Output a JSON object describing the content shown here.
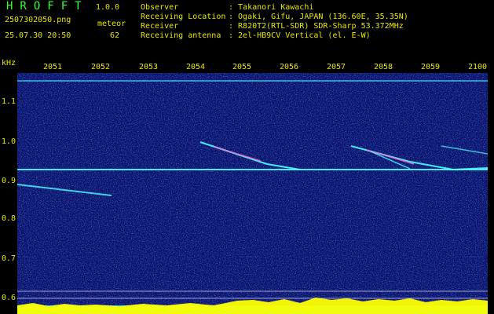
{
  "app": {
    "title": "HROFFT",
    "version": "1.0.0"
  },
  "file": {
    "name": "2507302050.png",
    "mode": "meteor",
    "datetime": "25.07.30 20:50",
    "count": "62"
  },
  "info": [
    {
      "label": "Observer",
      "value": ": Takanori Kawachi"
    },
    {
      "label": "Receiving Location",
      "value": ": Ogaki, Gifu, JAPAN (136.60E, 35.35N)"
    },
    {
      "label": "Receiver",
      "value": ": R820T2(RTL-SDR) SDR-Sharp 53.372MHz"
    },
    {
      "label": "Receiving antenna",
      "value": ": 2el-HB9CV Vertical (el. E-W)"
    }
  ],
  "axis": {
    "unit": "kHz",
    "time_labels": [
      "2051",
      "2052",
      "2053",
      "2054",
      "2055",
      "2056",
      "2057",
      "2058",
      "2059",
      "2100"
    ],
    "freq_labels": [
      "1.1",
      "1.0",
      "0.9",
      "0.8",
      "0.7",
      "0.6"
    ]
  },
  "colors": {
    "background": "#000000",
    "text": "#e8e800",
    "title": "#33ff33",
    "spectrogram_bg": "#0a0f6a",
    "trail": "#4dffff",
    "signal": "#ff66cc",
    "bottom_band": "#ffff00"
  }
}
